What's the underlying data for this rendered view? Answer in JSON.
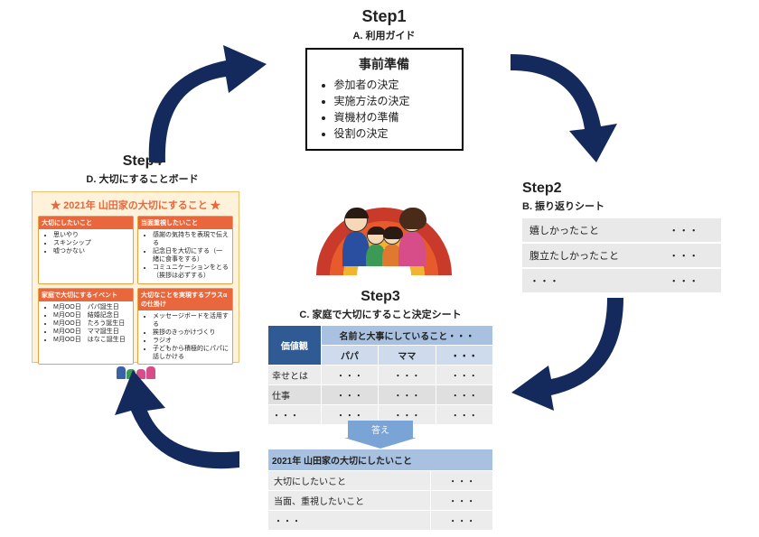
{
  "step1": {
    "label": "Step1",
    "sub": "A. 利用ガイド",
    "prep_title": "事前準備",
    "items": [
      "参加者の決定",
      "実施方法の決定",
      "資機材の準備",
      "役割の決定"
    ]
  },
  "step2": {
    "label": "Step2",
    "sub": "B. 振り返りシート",
    "rows": [
      {
        "k": "嬉しかったこと",
        "v": "・・・"
      },
      {
        "k": "腹立たしかったこと",
        "v": "・・・"
      },
      {
        "k": "・・・",
        "v": "・・・"
      }
    ]
  },
  "step3": {
    "label": "Step3",
    "sub": "C. 家庭で大切にすること決定シート",
    "head_values": "価値観",
    "head_main": "名前と大事にしていること・・・",
    "cols": [
      "パパ",
      "ママ",
      "・・・"
    ],
    "rows": [
      {
        "k": "幸せとは",
        "c": [
          "・・・",
          "・・・",
          "・・・"
        ]
      },
      {
        "k": "仕事",
        "c": [
          "・・・",
          "・・・",
          "・・・"
        ]
      },
      {
        "k": "・・・",
        "c": [
          "・・・",
          "・・・",
          "・・・"
        ]
      }
    ],
    "answer_label": "答え",
    "summary_title": "2021年 山田家の大切にしたいこと",
    "summary": [
      {
        "k": "大切にしたいこと",
        "v": "・・・"
      },
      {
        "k": "当面、重視したいこと",
        "v": "・・・"
      },
      {
        "k": "・・・",
        "v": "・・・"
      }
    ]
  },
  "step4": {
    "label": "Step4",
    "sub": "D. 大切にすることボード",
    "board_title": "2021年 山田家の大切にすること",
    "cards": [
      {
        "h": "大切にしたいこと",
        "items": [
          "思いやり",
          "スキンシップ",
          "嘘つかない"
        ]
      },
      {
        "h": "当面重視したいこと",
        "items": [
          "感謝の気持ちを表現で伝える",
          "記念日を大切にする（一緒に食事をする）",
          "コミュニケーションをとる（挨拶は必ずする）"
        ]
      },
      {
        "h": "家庭で大切にするイベント",
        "items": [
          "M月OO日　パパ誕生日",
          "M月OO日　結婚記念日",
          "M月OO日　たろう誕生日",
          "M月OO日　ママ誕生日",
          "M月OO日　はなこ誕生日"
        ]
      },
      {
        "h": "大切なことを実現するプラスαの仕掛け",
        "items": [
          "メッセージボードを活用する",
          "挨拶のきっかけづくり",
          "ラジオ",
          "子どもから積極的にパパに話しかける"
        ]
      }
    ]
  },
  "star": "★"
}
